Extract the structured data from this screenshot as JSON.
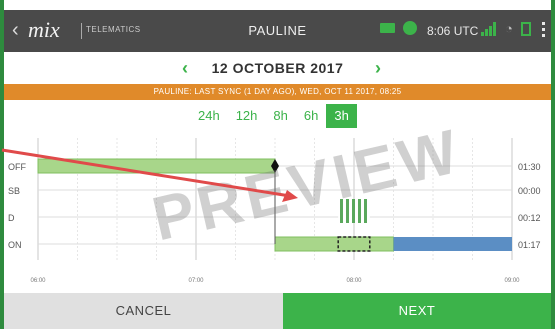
{
  "statusbar": {
    "brand": "mix",
    "brand_sub": "TELEMATICS",
    "driver": "PAULINE",
    "time": "8:06 UTC"
  },
  "date_nav": {
    "prev_icon": "chevron-left-icon",
    "date": "12 OCTOBER 2017",
    "next_icon": "chevron-right-icon"
  },
  "sync_banner": "PAULINE: LAST SYNC (1 DAY AGO), WED, OCT 11 2017, 08:25",
  "range_tabs": [
    {
      "label": "24h",
      "active": false
    },
    {
      "label": "12h",
      "active": false
    },
    {
      "label": "8h",
      "active": false
    },
    {
      "label": "6h",
      "active": false
    },
    {
      "label": "3h",
      "active": true
    }
  ],
  "chart_data": {
    "type": "timeline",
    "rows": [
      "OFF",
      "SB",
      "D",
      "ON"
    ],
    "row_totals": [
      "01:30",
      "00:00",
      "00:12",
      "01:17"
    ],
    "x_ticks": [
      "06:00",
      "07:00",
      "08:00",
      "09:00"
    ],
    "segments": [
      {
        "row": "OFF",
        "start": 6.0,
        "end": 7.5,
        "color": "#a8d68a"
      },
      {
        "row": "D",
        "start": 7.9,
        "end": 8.1,
        "color": "#5aa85c",
        "pattern": "striped"
      },
      {
        "row": "ON",
        "start": 7.5,
        "end": 8.25,
        "color": "#a8d68a"
      },
      {
        "row": "ON",
        "start": 8.25,
        "end": 9.0,
        "color": "#5b8ec4"
      }
    ],
    "selection": {
      "row": "ON",
      "start": 7.9,
      "end": 8.1
    },
    "current_marker": {
      "row": "OFF",
      "time": 7.5
    }
  },
  "watermark": "PREVIEW",
  "buttons": {
    "cancel": "CANCEL",
    "next": "NEXT"
  },
  "colors": {
    "accent": "#3cb34a",
    "sync_bar": "#e08a2a",
    "statusbar": "#4a4a4a",
    "arrow": "#e04a4a"
  }
}
